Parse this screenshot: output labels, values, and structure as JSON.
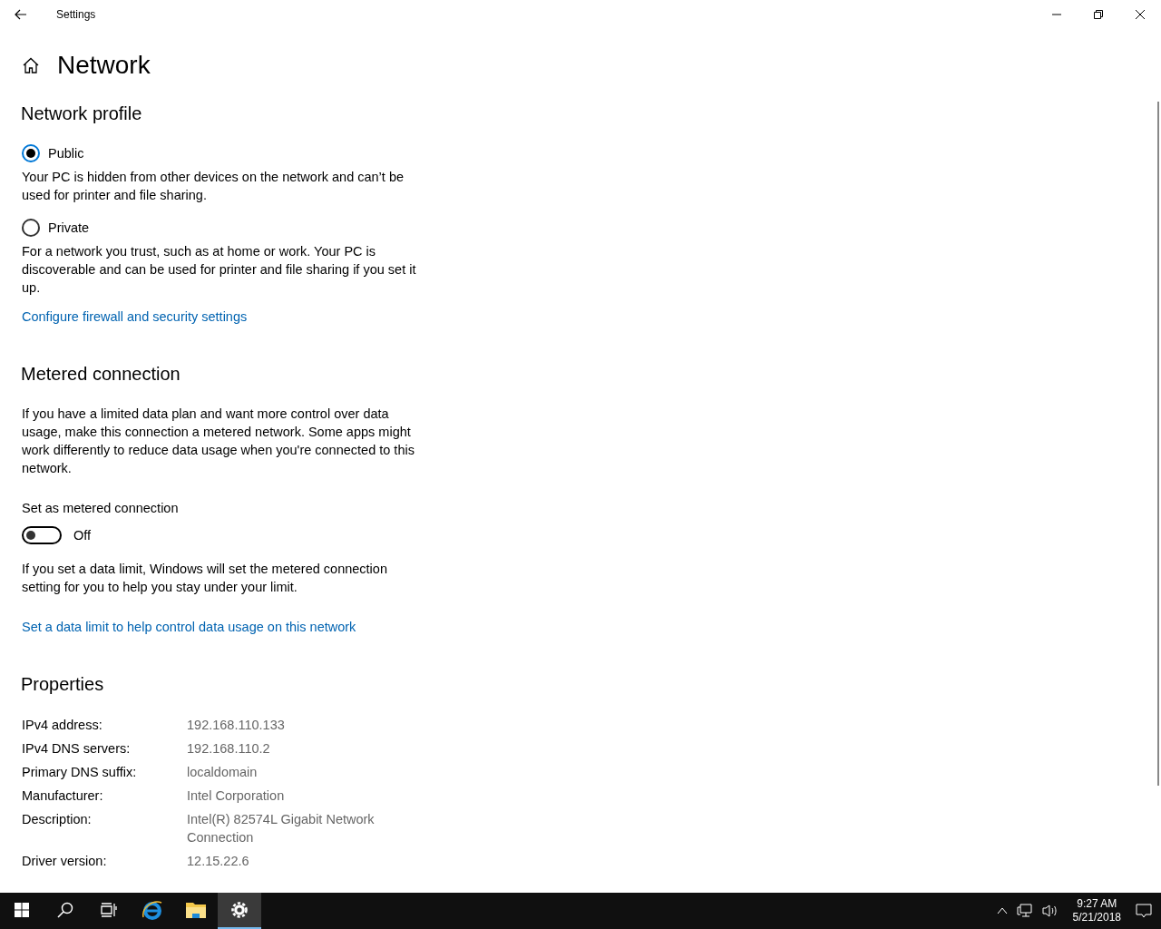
{
  "window": {
    "title": "Settings"
  },
  "page": {
    "title": "Network"
  },
  "network_profile": {
    "heading": "Network profile",
    "options": [
      {
        "label": "Public",
        "selected": true,
        "description": "Your PC is hidden from other devices on the network and can’t be used for printer and file sharing."
      },
      {
        "label": "Private",
        "selected": false,
        "description": "For a network you trust, such as at home or work. Your PC is discoverable and can be used for printer and file sharing if you set it up."
      }
    ],
    "link": "Configure firewall and security settings"
  },
  "metered_connection": {
    "heading": "Metered connection",
    "description": "If you have a limited data plan and want more control over data usage, make this connection a metered network. Some apps might work differently to reduce data usage when you're connected to this network.",
    "toggle": {
      "label": "Set as metered connection",
      "on": false,
      "state_text": "Off"
    },
    "note": "If you set a data limit, Windows will set the metered connection setting for you to help you stay under your limit.",
    "link": "Set a data limit to help control data usage on this network"
  },
  "properties": {
    "heading": "Properties",
    "rows": [
      {
        "label": "IPv4 address:",
        "value": "192.168.110.133"
      },
      {
        "label": "IPv4 DNS servers:",
        "value": "192.168.110.2"
      },
      {
        "label": "Primary DNS suffix:",
        "value": "localdomain"
      },
      {
        "label": "Manufacturer:",
        "value": "Intel Corporation"
      },
      {
        "label": "Description:",
        "value": "Intel(R) 82574L Gigabit Network Connection"
      },
      {
        "label": "Driver version:",
        "value": "12.15.22.6"
      }
    ]
  },
  "taskbar": {
    "items": [
      {
        "kind": "start",
        "selected": false
      },
      {
        "kind": "search",
        "selected": false
      },
      {
        "kind": "task-view",
        "selected": false
      },
      {
        "kind": "browser",
        "selected": false
      },
      {
        "kind": "folder",
        "selected": false
      },
      {
        "kind": "settings",
        "selected": true
      }
    ],
    "time": "9:27 AM",
    "date": "5/21/2018"
  }
}
